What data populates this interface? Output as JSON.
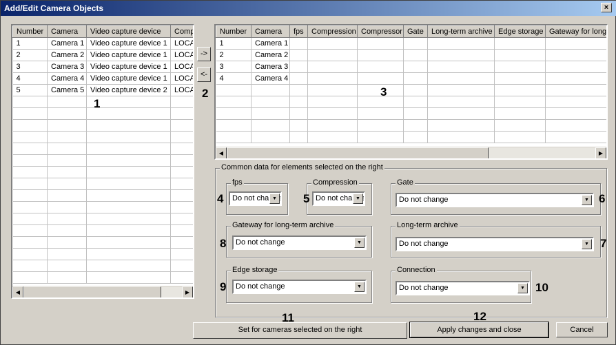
{
  "window": {
    "title": "Add/Edit Camera Objects",
    "close": "×"
  },
  "left_table": {
    "columns": [
      "Number",
      "Camera",
      "Video capture device",
      "Computer"
    ],
    "rows": [
      [
        "1",
        "Camera 1",
        "Video capture device 1",
        "LOCAL"
      ],
      [
        "2",
        "Camera 2",
        "Video capture device 1",
        "LOCAL"
      ],
      [
        "3",
        "Camera 3",
        "Video capture device 1",
        "LOCAL"
      ],
      [
        "4",
        "Camera 4",
        "Video capture device 1",
        "LOCAL"
      ],
      [
        "5",
        "Camera 5",
        "Video capture device 2",
        "LOCAL"
      ]
    ]
  },
  "transfer": {
    "add": "->",
    "remove": "<-"
  },
  "right_table": {
    "columns": [
      "Number",
      "Camera",
      "fps",
      "Compression",
      "Compressor",
      "Gate",
      "Long-term archive",
      "Edge storage",
      "Gateway for long-term archive"
    ],
    "rows": [
      [
        "1",
        "Camera 1",
        "",
        "",
        "",
        "",
        "",
        "",
        ""
      ],
      [
        "2",
        "Camera 2",
        "",
        "",
        "",
        "",
        "",
        "",
        ""
      ],
      [
        "3",
        "Camera 3",
        "",
        "",
        "",
        "",
        "",
        "",
        ""
      ],
      [
        "4",
        "Camera 4",
        "",
        "",
        "",
        "",
        "",
        "",
        ""
      ]
    ]
  },
  "common": {
    "title": "Common data for elements selected on the right",
    "fps": {
      "label": "fps",
      "value": "Do not change"
    },
    "compression": {
      "label": "Compression",
      "value": "Do not change"
    },
    "gate": {
      "label": "Gate",
      "value": "Do not change"
    },
    "gateway": {
      "label": "Gateway for long-term archive",
      "value": "Do not change"
    },
    "longterm": {
      "label": "Long-term archive",
      "value": "Do not change"
    },
    "edge": {
      "label": "Edge storage",
      "value": "Do not change"
    },
    "connection": {
      "label": "Connection",
      "value": "Do not change"
    }
  },
  "buttons": {
    "set": "Set for cameras selected on the right",
    "apply": "Apply changes and close",
    "cancel": "Cancel"
  },
  "annotations": [
    "1",
    "2",
    "3",
    "4",
    "5",
    "6",
    "7",
    "8",
    "9",
    "10",
    "11",
    "12"
  ]
}
